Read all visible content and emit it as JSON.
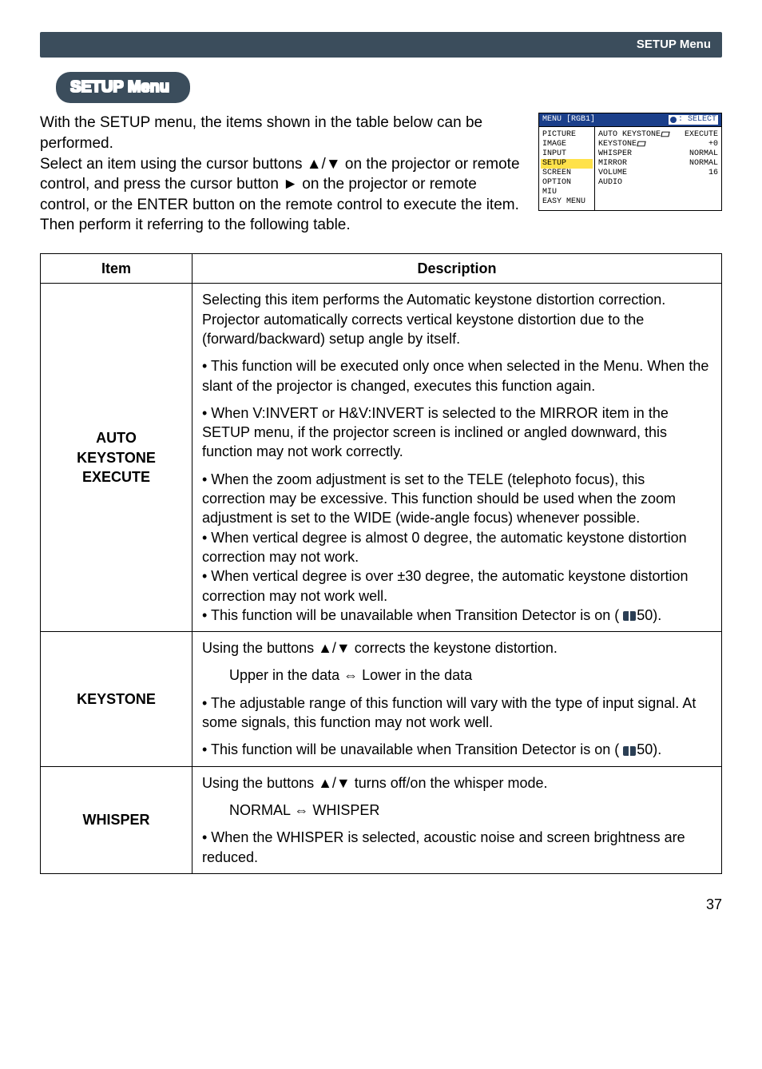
{
  "header_bar": "SETUP Menu",
  "badge": "SETUP Menu",
  "intro": "With the SETUP menu, the items shown in the table below can be performed.\nSelect an item using the cursor buttons ▲/▼ on the projector or remote control, and press the cursor button ► on the projector or remote control, or the ENTER button on the remote control to execute the item. Then perform it referring to the following table.",
  "osd": {
    "title_left": "MENU [RGB1]",
    "title_right": ": SELECT",
    "left_items": [
      "PICTURE",
      "IMAGE",
      "INPUT",
      "SETUP",
      "SCREEN",
      "OPTION",
      "MIU",
      "EASY MENU"
    ],
    "highlight_index": 3,
    "right_rows": [
      {
        "label": "AUTO KEYSTONE",
        "icon": true,
        "value": "EXECUTE"
      },
      {
        "label": "KEYSTONE",
        "icon": true,
        "value": "+0"
      },
      {
        "label": "WHISPER",
        "icon": false,
        "value": "NORMAL"
      },
      {
        "label": "MIRROR",
        "icon": false,
        "value": "NORMAL"
      },
      {
        "label": "VOLUME",
        "icon": false,
        "value": "16"
      },
      {
        "label": "AUDIO",
        "icon": false,
        "value": ""
      }
    ]
  },
  "table": {
    "head_item": "Item",
    "head_desc": "Description",
    "rows": [
      {
        "item": "AUTO\nKEYSTONE\nEXECUTE",
        "paras": [
          "Selecting this item performs the Automatic keystone distortion correction. Projector automatically corrects vertical keystone distortion due to the (forward/backward) setup angle by itself.",
          "• This function will be executed only once when selected in the Menu. When the slant of the projector is changed, executes this function again.",
          "• When V:INVERT or H&V:INVERT is selected to the MIRROR item in the SETUP menu, if the projector screen is inclined or angled downward, this function may not work correctly.",
          "• When the zoom adjustment is set to the TELE (telephoto focus), this correction may be excessive. This function should be used when the zoom adjustment is set to the WIDE (wide-angle focus) whenever possible.\n• When vertical degree is almost 0 degree, the automatic keystone distortion correction may not work.\n• When vertical degree is over ±30 degree, the automatic keystone distortion correction may not work well.\n• This function will be unavailable when Transition Detector is on ( 📖50)."
        ]
      },
      {
        "item": "KEYSTONE",
        "paras": [
          "Using the buttons ▲/▼ corrects the keystone distortion.",
          "indent::Upper in the data ⇔ Lower in the data",
          "• The adjustable range of this function will vary with the type of input signal. At some signals, this function may not work well.",
          "• This function will be unavailable when Transition Detector is on ( 📖50)."
        ]
      },
      {
        "item": "WHISPER",
        "paras": [
          "Using the buttons ▲/▼ turns off/on the whisper mode.",
          "indent::NORMAL ⇔ WHISPER",
          "• When the WHISPER is selected, acoustic noise and screen brightness are reduced."
        ]
      }
    ]
  },
  "page": "37"
}
